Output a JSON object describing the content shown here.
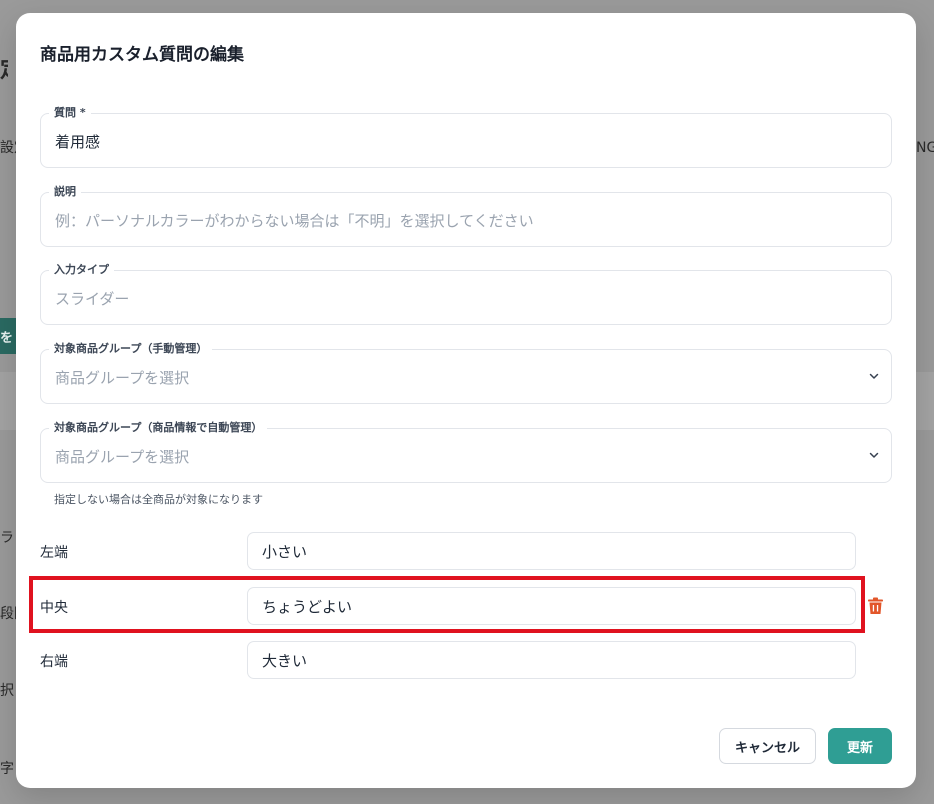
{
  "background": {
    "fragments": [
      "定",
      "設定",
      "NGワ",
      "を",
      "ラ",
      "段階",
      "択",
      "字"
    ]
  },
  "modal": {
    "title": "商品用カスタム質問の編集",
    "fields": {
      "question": {
        "label": "質問 *",
        "value": "着用感"
      },
      "description": {
        "label": "説明",
        "placeholder": "例：パーソナルカラーがわからない場合は「不明」を選択してください"
      },
      "input_type": {
        "label": "入力タイプ",
        "value": "スライダー"
      },
      "group_manual": {
        "label": "対象商品グループ（手動管理）",
        "placeholder": "商品グループを選択"
      },
      "group_auto": {
        "label": "対象商品グループ（商品情報で自動管理）",
        "placeholder": "商品グループを選択"
      }
    },
    "helper_text": "指定しない場合は全商品が対象になります",
    "slider_labels": [
      {
        "position": "左端",
        "value": "小さい"
      },
      {
        "position": "中央",
        "value": "ちょうどよい"
      },
      {
        "position": "右端",
        "value": "大きい"
      }
    ],
    "buttons": {
      "cancel": "キャンセル",
      "update": "更新"
    }
  },
  "colors": {
    "accent": "#2f9e94",
    "highlight": "#e0121f",
    "delete_icon": "#e2562a",
    "overlay": "#9a9a9a"
  },
  "icons": {
    "select_chevron": "chevron-down-icon",
    "delete": "trash-icon"
  }
}
